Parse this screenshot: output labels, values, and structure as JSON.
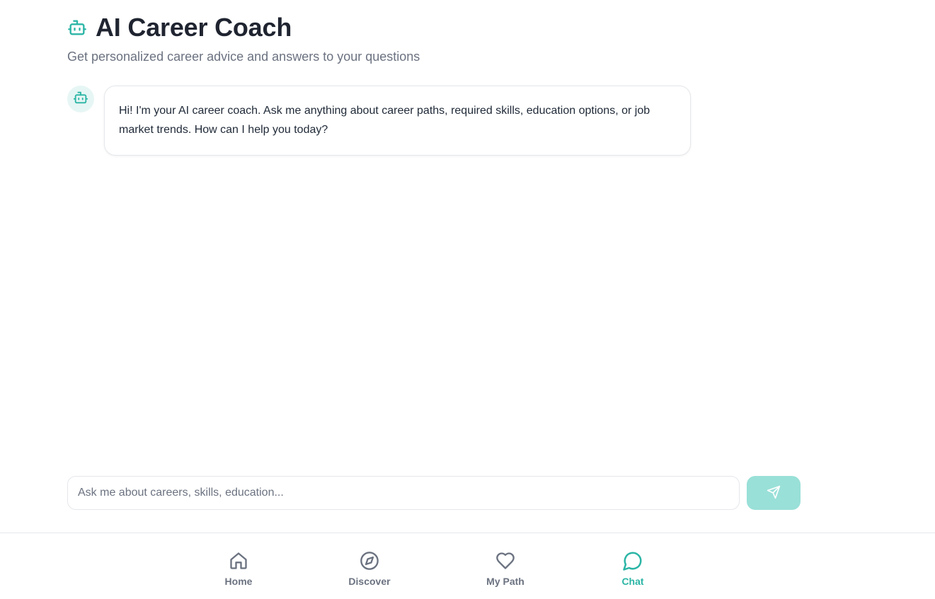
{
  "header": {
    "title": "AI Career Coach",
    "subtitle": "Get personalized career advice and answers to your questions",
    "icon": "robot-icon"
  },
  "messages": [
    {
      "role": "assistant",
      "avatar_icon": "robot-icon",
      "text": "Hi! I'm your AI career coach. Ask me anything about career paths, required skills, education options, or job market trends. How can I help you today?"
    }
  ],
  "composer": {
    "placeholder": "Ask me about careers, skills, education...",
    "value": "",
    "send_icon": "send-icon"
  },
  "nav": {
    "items": [
      {
        "label": "Home",
        "icon": "home-icon",
        "active": false
      },
      {
        "label": "Discover",
        "icon": "compass-icon",
        "active": false
      },
      {
        "label": "My Path",
        "icon": "heart-icon",
        "active": false
      },
      {
        "label": "Chat",
        "icon": "chat-icon",
        "active": true
      }
    ]
  },
  "colors": {
    "accent": "#2bb5a5",
    "send_button": "#99e0d8",
    "avatar_bg": "#e6f6f4",
    "muted_text": "#6b7280"
  }
}
